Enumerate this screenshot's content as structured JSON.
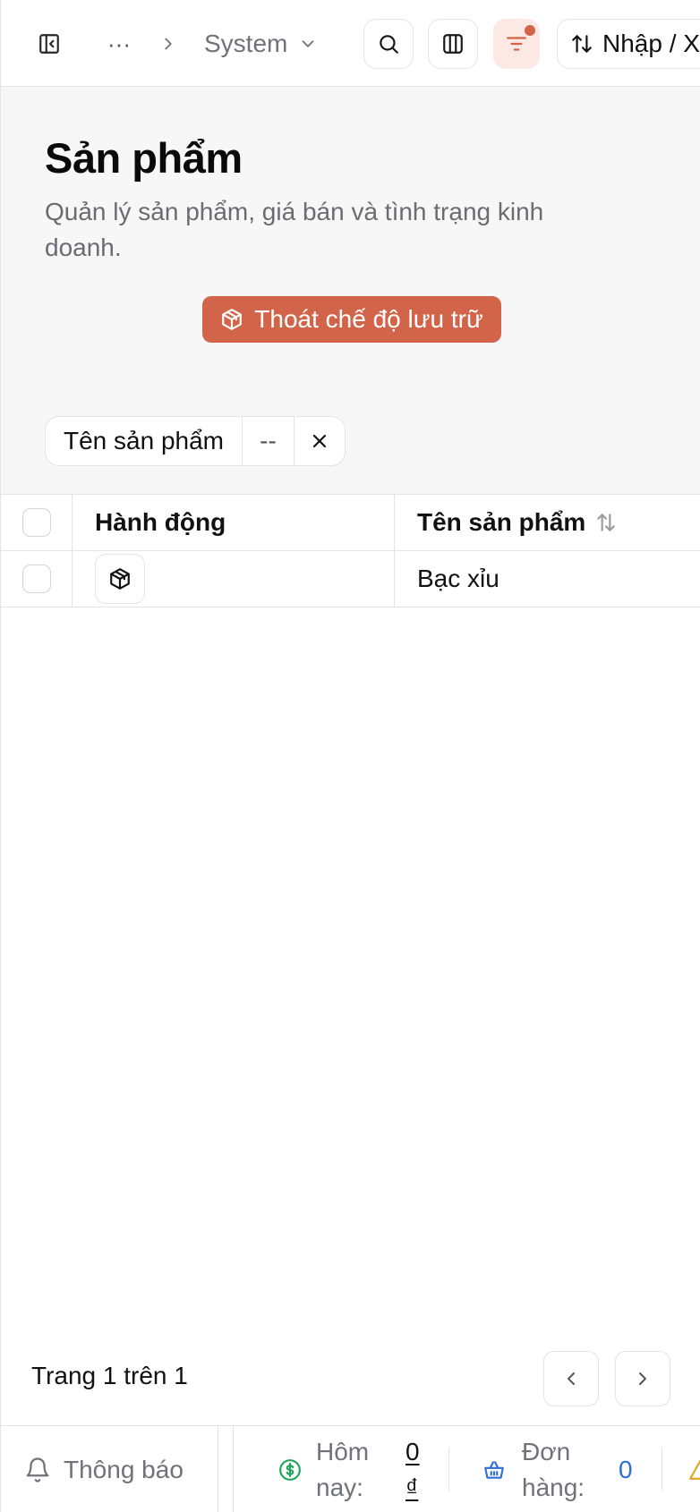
{
  "topbar": {
    "breadcrumb_ellipsis": "···",
    "breadcrumb_current": "System",
    "io_button_label": "Nhập / Xuất"
  },
  "header": {
    "title": "Sản phẩm",
    "description": "Quản lý sản phẩm, giá bán và tình trạng kinh doanh.",
    "archive_button_label": "Thoát chế độ lưu trữ"
  },
  "filter": {
    "field": "Tên sản phẩm",
    "value": "--"
  },
  "table": {
    "columns": [
      "Hành động",
      "Tên sản phẩm"
    ],
    "rows": [
      {
        "name": "Bạc xỉu"
      }
    ]
  },
  "pagination": {
    "text": "Trang 1 trên 1"
  },
  "statusbar": {
    "notifications_label": "Thông báo",
    "today_label": "Hôm nay:",
    "today_value": "0 ₫",
    "orders_label": "Đơn hàng:",
    "orders_value": "0"
  },
  "colors": {
    "accent": "#d2644a",
    "accent_soft": "#fce9e4",
    "money": "#22a55a",
    "orders": "#2f6fd6",
    "warning": "#e0a81e"
  },
  "icons": [
    "sidebar-toggle-icon",
    "chevron-right-icon",
    "chevron-down-icon",
    "search-icon",
    "columns-icon",
    "filter-icon",
    "sort-icon",
    "archive-box-icon",
    "x-icon",
    "chevron-left-icon",
    "bell-icon",
    "dollar-circle-icon",
    "basket-icon",
    "warning-icon"
  ]
}
